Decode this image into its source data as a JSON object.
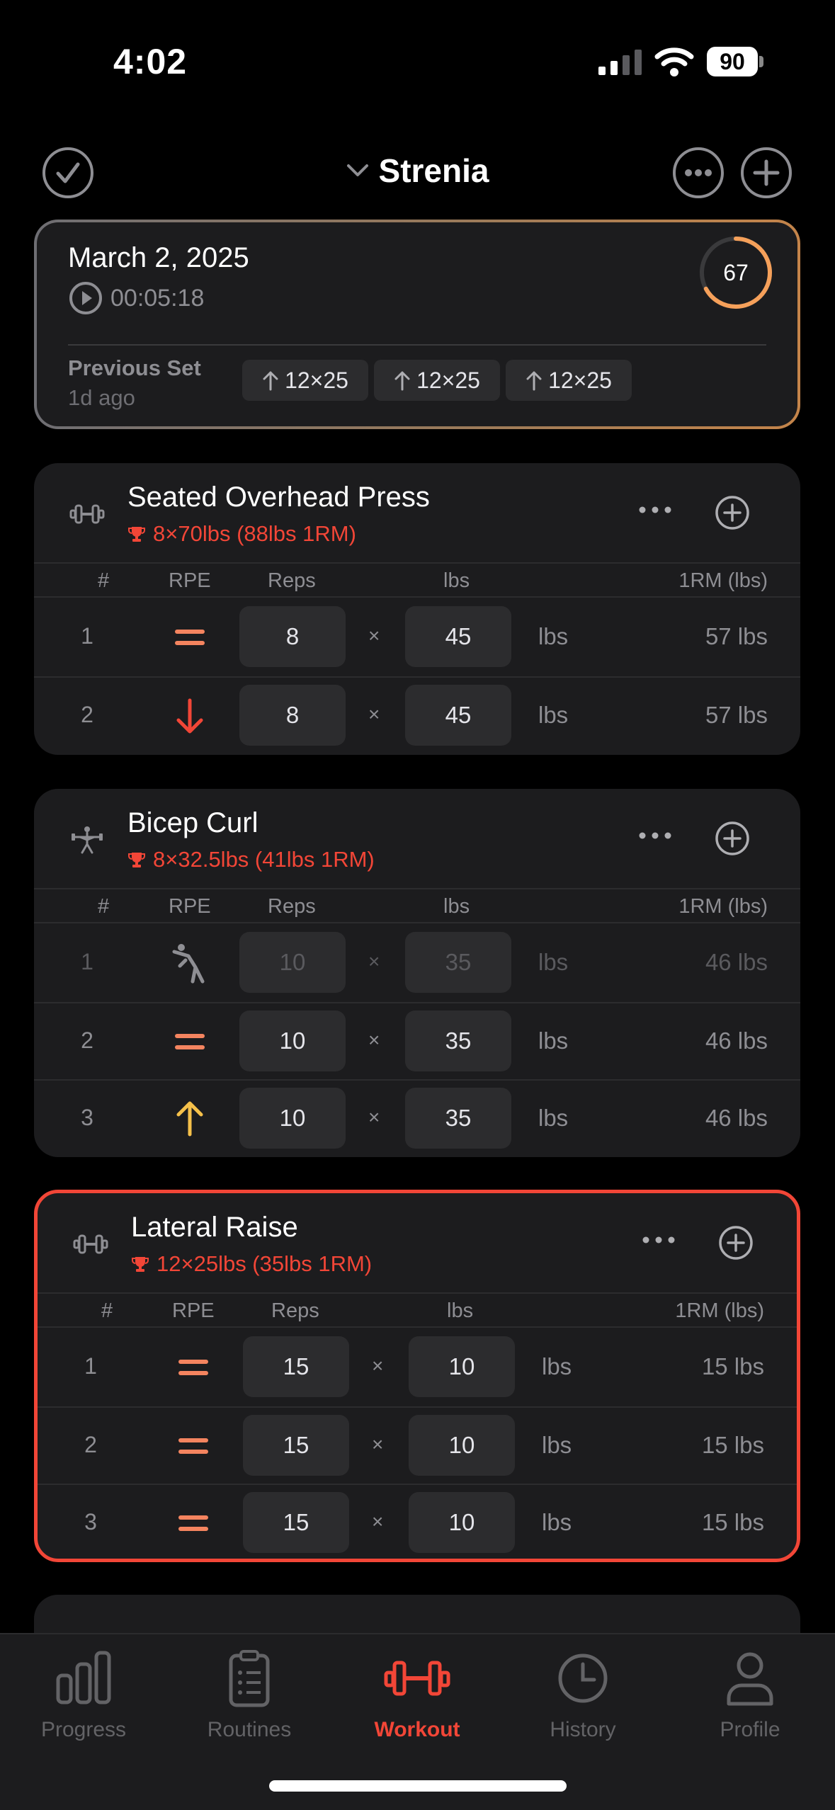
{
  "status": {
    "time": "4:02",
    "battery": "90"
  },
  "header": {
    "title": "Strenia"
  },
  "summary": {
    "date": "March 2, 2025",
    "timer": "00:05:18",
    "score": "67",
    "score_progress": 0.67,
    "previous_label": "Previous Set",
    "previous_ago": "1d ago",
    "previous_sets": [
      "12×25",
      "12×25",
      "12×25"
    ]
  },
  "columns": {
    "num": "#",
    "rpe": "RPE",
    "reps": "Reps",
    "weight": "lbs",
    "orm": "1RM (lbs)"
  },
  "times_symbol": "×",
  "exercises": [
    {
      "name": "Seated Overhead Press",
      "icon": "dumbbell-icon",
      "pr": "8×70lbs (88lbs 1RM)",
      "sets": [
        {
          "num": "1",
          "rpe": "equal",
          "reps": "8",
          "weight": "45",
          "unit": "lbs",
          "orm": "57 lbs"
        },
        {
          "num": "2",
          "rpe": "down",
          "reps": "8",
          "weight": "45",
          "unit": "lbs",
          "orm": "57 lbs"
        }
      ]
    },
    {
      "name": "Bicep Curl",
      "icon": "person-lifting-icon",
      "pr": "8×32.5lbs (41lbs 1RM)",
      "sets": [
        {
          "num": "1",
          "rpe": "warmup",
          "reps": "10",
          "weight": "35",
          "unit": "lbs",
          "orm": "46 lbs"
        },
        {
          "num": "2",
          "rpe": "equal",
          "reps": "10",
          "weight": "35",
          "unit": "lbs",
          "orm": "46 lbs"
        },
        {
          "num": "3",
          "rpe": "up",
          "reps": "10",
          "weight": "35",
          "unit": "lbs",
          "orm": "46 lbs"
        }
      ]
    },
    {
      "name": "Lateral Raise",
      "icon": "dumbbell-icon",
      "pr": "12×25lbs (35lbs 1RM)",
      "sets": [
        {
          "num": "1",
          "rpe": "equal",
          "reps": "15",
          "weight": "10",
          "unit": "lbs",
          "orm": "15 lbs"
        },
        {
          "num": "2",
          "rpe": "equal",
          "reps": "15",
          "weight": "10",
          "unit": "lbs",
          "orm": "15 lbs"
        },
        {
          "num": "3",
          "rpe": "equal",
          "reps": "15",
          "weight": "10",
          "unit": "lbs",
          "orm": "15 lbs"
        }
      ]
    }
  ],
  "tabs": [
    {
      "label": "Progress",
      "icon": "bar-chart-icon"
    },
    {
      "label": "Routines",
      "icon": "clipboard-icon"
    },
    {
      "label": "Workout",
      "icon": "dumbbell-icon",
      "active": true
    },
    {
      "label": "History",
      "icon": "clock-icon"
    },
    {
      "label": "Profile",
      "icon": "person-icon"
    }
  ],
  "colors": {
    "accent": "#f24637",
    "rpe_equal": "#f4845f",
    "rpe_down": "#f24637",
    "rpe_up": "#f5c04a"
  }
}
